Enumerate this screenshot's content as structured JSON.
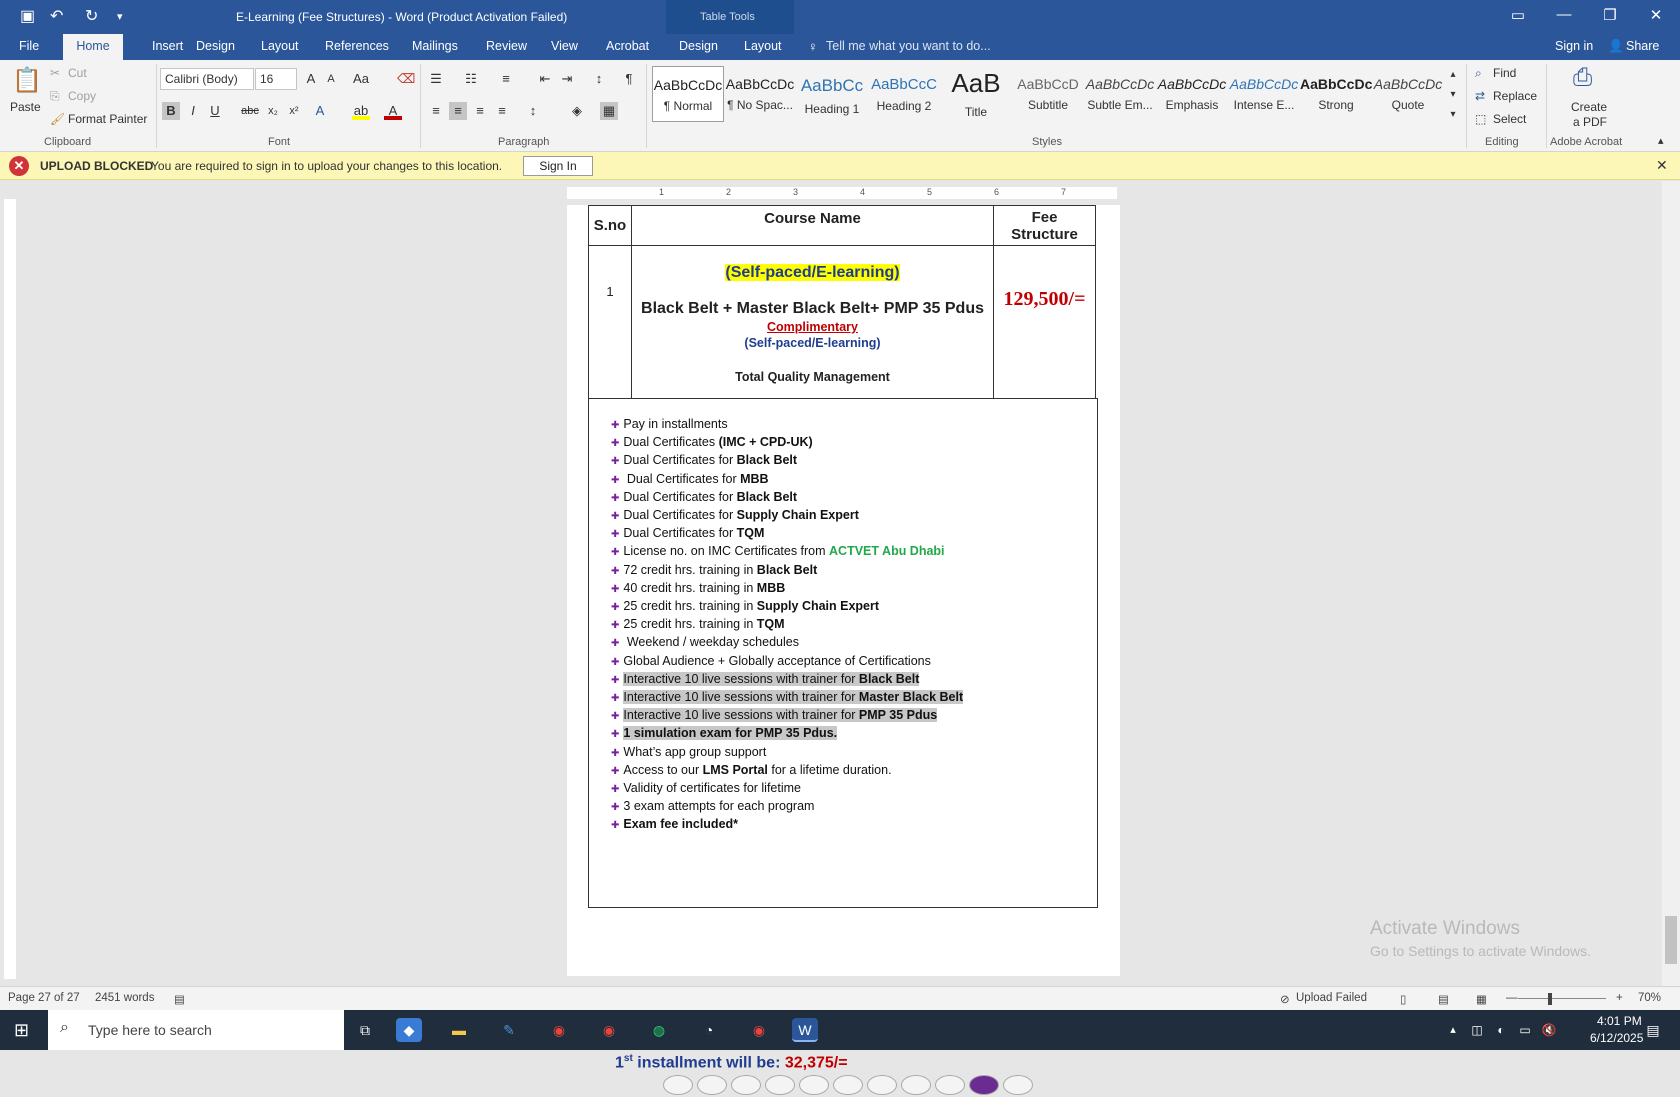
{
  "titlebar": {
    "title": "E-Learning (Fee Structures) - Word (Product Activation Failed)",
    "context_tab": "Table Tools"
  },
  "tabs": [
    "File",
    "Home",
    "Insert",
    "Design",
    "Layout",
    "References",
    "Mailings",
    "Review",
    "View",
    "Acrobat",
    "Design",
    "Layout"
  ],
  "tellme": "Tell me what you want to do...",
  "signin": "Sign in",
  "share": "Share",
  "ribbon": {
    "clipboard": {
      "paste": "Paste",
      "cut": "Cut",
      "copy": "Copy",
      "format_painter": "Format Painter",
      "label": "Clipboard"
    },
    "font": {
      "family": "Calibri (Body)",
      "size": "16",
      "label": "Font"
    },
    "paragraph": {
      "label": "Paragraph"
    },
    "styles": {
      "label": "Styles",
      "items": [
        {
          "sample": "AaBbCcDc",
          "name": "¶ Normal"
        },
        {
          "sample": "AaBbCcDc",
          "name": "¶ No Spac..."
        },
        {
          "sample": "AaBbCc",
          "name": "Heading 1"
        },
        {
          "sample": "AaBbCcC",
          "name": "Heading 2"
        },
        {
          "sample": "AaB",
          "name": "Title"
        },
        {
          "sample": "AaBbCcD",
          "name": "Subtitle"
        },
        {
          "sample": "AaBbCcDc",
          "name": "Subtle Em..."
        },
        {
          "sample": "AaBbCcDc",
          "name": "Emphasis"
        },
        {
          "sample": "AaBbCcDc",
          "name": "Intense E..."
        },
        {
          "sample": "AaBbCcDc",
          "name": "Strong"
        },
        {
          "sample": "AaBbCcDc",
          "name": "Quote"
        }
      ]
    },
    "editing": {
      "find": "Find",
      "replace": "Replace",
      "select": "Select",
      "label": "Editing"
    },
    "acrobat": {
      "create": "Create",
      "pdf": "a PDF",
      "label": "Adobe Acrobat"
    }
  },
  "message": {
    "title": "UPLOAD BLOCKED",
    "text": "You are required to sign in to upload your changes to this location.",
    "button": "Sign In"
  },
  "ruler": [
    "1",
    "2",
    "3",
    "4",
    "5",
    "6",
    "7"
  ],
  "table": {
    "h_sno": "S.no",
    "h_course": "Course Name",
    "h_fee1": "Fee",
    "h_fee2": "Structure",
    "sno": "1",
    "mode": "(Self-paced/E-learning)",
    "course": "Black Belt + Master Black Belt+  PMP 35 Pdus",
    "complimentary": "Complimentary",
    "mode2": "(Self-paced/E-learning)",
    "tqm": "Total Quality Management",
    "fee": "129,500/="
  },
  "features": [
    {
      "a": "Pay in installments",
      "b": "",
      "c": ""
    },
    {
      "a": "Dual Certificates ",
      "b": "(IMC + CPD-UK)",
      "c": ""
    },
    {
      "a": "Dual Certificates for ",
      "b": "Black Belt",
      "c": ""
    },
    {
      "a": " Dual Certificates for ",
      "b": "MBB",
      "c": ""
    },
    {
      "a": "Dual Certificates for ",
      "b": "Black Belt",
      "c": ""
    },
    {
      "a": "Dual Certificates for ",
      "b": "Supply Chain Expert",
      "c": ""
    },
    {
      "a": "Dual Certificates for ",
      "b": "TQM",
      "c": ""
    },
    {
      "a": "License no. on IMC Certificates from ",
      "b": "",
      "c": "ACTVET Abu Dhabi"
    },
    {
      "a": "72 credit hrs. training in ",
      "b": "Black Belt",
      "c": ""
    },
    {
      "a": "40 credit hrs. training in ",
      "b": "MBB",
      "c": ""
    },
    {
      "a": "25 credit hrs. training in ",
      "b": "Supply Chain Expert",
      "c": ""
    },
    {
      "a": "25 credit hrs. training in ",
      "b": "TQM",
      "c": ""
    },
    {
      "a": " Weekend / weekday schedules",
      "b": "",
      "c": ""
    },
    {
      "a": "Global Audience + Globally acceptance of Certifications",
      "b": "",
      "c": ""
    },
    {
      "a": "Interactive 10 live sessions with trainer for ",
      "b": "Black Belt",
      "c": "",
      "sel": true
    },
    {
      "a": "Interactive 10 live sessions with trainer for ",
      "b": "Master Black Belt",
      "c": "",
      "sel": true
    },
    {
      "a": "Interactive 10 live sessions with trainer for ",
      "b": "PMP 35 Pdus",
      "c": "",
      "sel": true
    },
    {
      "a": "",
      "b": "1 simulation exam for PMP 35 Pdus.",
      "c": "",
      "sel": true
    },
    {
      "a": "What’s app group support",
      "b": "",
      "c": ""
    },
    {
      "a": "Access to our ",
      "b": "LMS Portal",
      "c2": " for a lifetime duration."
    },
    {
      "a": "Validity of certificates for lifetime",
      "b": "",
      "c": ""
    },
    {
      "a": "3 exam attempts for each program",
      "b": "",
      "c": ""
    },
    {
      "a": "",
      "b": "Exam fee included*",
      "c": ""
    }
  ],
  "installment": {
    "pre": "1",
    "sup": "st",
    "mid": " installment will be: ",
    "amount": "32,375/="
  },
  "watermark": {
    "l1": "Activate Windows",
    "l2": "Go to Settings to activate Windows."
  },
  "status": {
    "page": "Page 27 of 27",
    "words": "2451 words",
    "upload": "Upload Failed",
    "zoom": "70%"
  },
  "taskbar": {
    "search": "Type here to search",
    "time": "4:01 PM",
    "date": "6/12/2025"
  }
}
